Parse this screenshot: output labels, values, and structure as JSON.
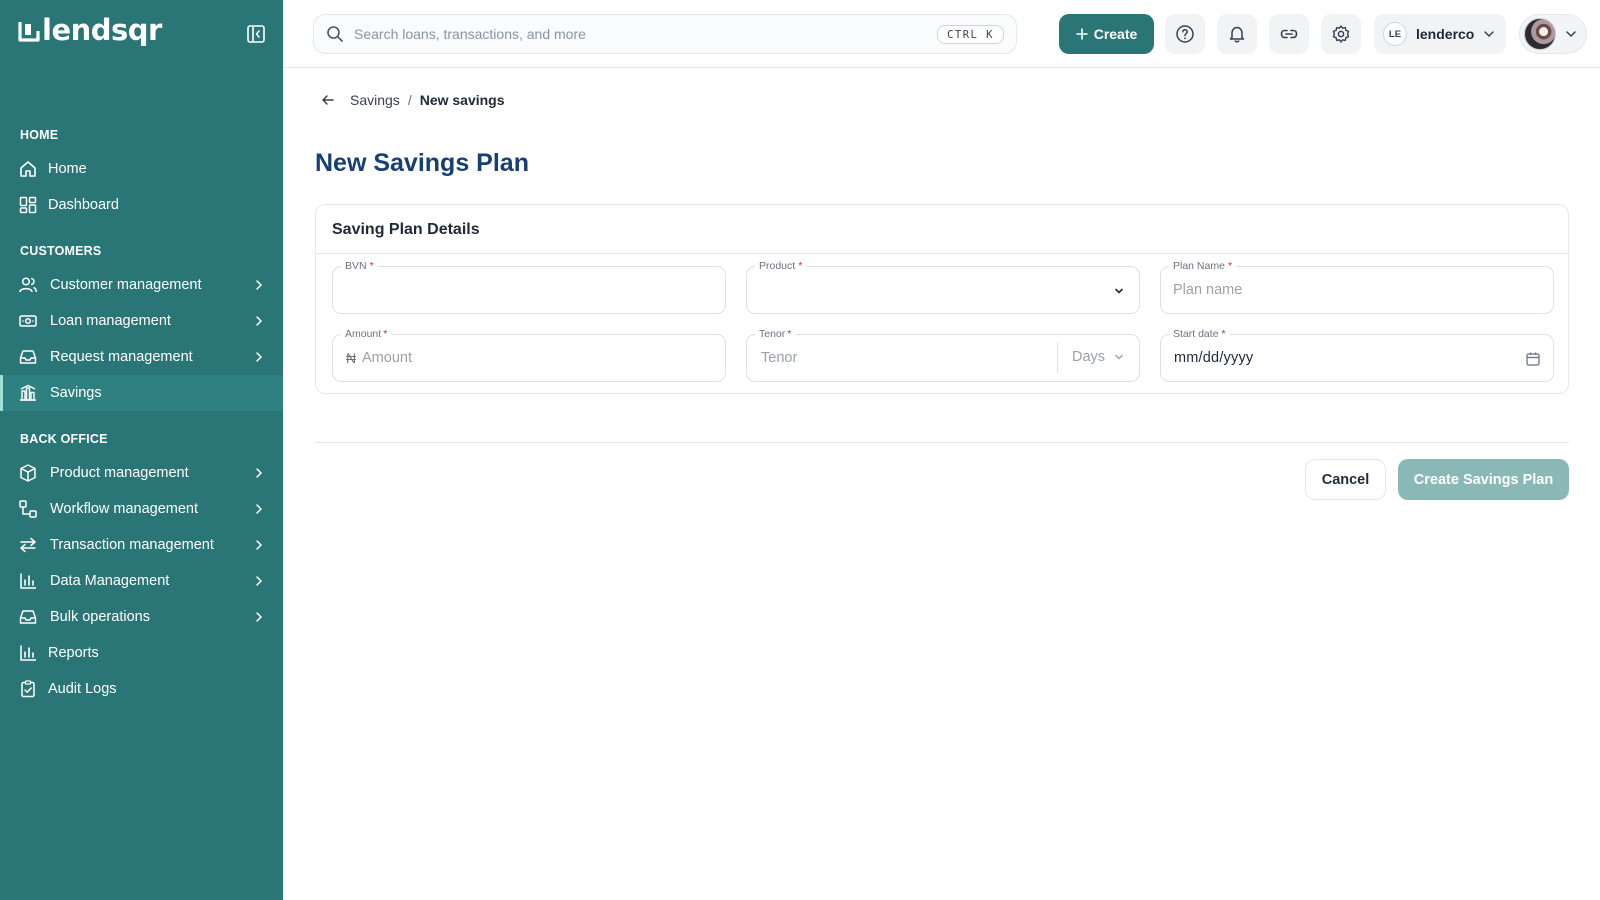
{
  "brand": {
    "logo_text": "lendsqr",
    "logo_icon": "lendsqr-logo-mark"
  },
  "sidebar": {
    "collapse_icon": "sidebar-collapse-icon",
    "sections": {
      "home": "HOME",
      "customers": "CUSTOMERS",
      "back_office": "BACK OFFICE"
    },
    "items": [
      {
        "label": "Home",
        "icon": "home-icon"
      },
      {
        "label": "Dashboard",
        "icon": "dashboard-grid-icon"
      },
      {
        "label": "Customer management",
        "icon": "users-icon"
      },
      {
        "label": "Loan management",
        "icon": "cash-icon"
      },
      {
        "label": "Request management",
        "icon": "inbox-icon"
      },
      {
        "label": "Savings",
        "icon": "bank-icon",
        "active": true
      },
      {
        "label": "Product management",
        "icon": "box-icon"
      },
      {
        "label": "Workflow management",
        "icon": "workflow-icon"
      },
      {
        "label": "Transaction management",
        "icon": "transfer-arrows-icon"
      },
      {
        "label": "Data Management",
        "icon": "bar-chart-icon"
      },
      {
        "label": "Bulk operations",
        "icon": "inbox-icon"
      },
      {
        "label": "Reports",
        "icon": "bar-chart-icon"
      },
      {
        "label": "Audit Logs",
        "icon": "clipboard-check-icon"
      }
    ]
  },
  "topbar": {
    "search": {
      "placeholder": "Search loans, transactions, and more",
      "shortcut": "CTRL K"
    },
    "create_label": "Create",
    "account": {
      "initials": "LE",
      "name": "lenderco"
    }
  },
  "breadcrumb": {
    "parent": "Savings",
    "separator": "/",
    "current": "New savings"
  },
  "page": {
    "title": "New Savings Plan"
  },
  "form": {
    "card_title": "Saving Plan Details",
    "fields": {
      "bvn": {
        "label": "BVN",
        "value": "",
        "placeholder": ""
      },
      "product": {
        "label": "Product",
        "value": ""
      },
      "plan_name": {
        "label": "Plan Name",
        "value": "",
        "placeholder": "Plan name"
      },
      "amount": {
        "label": "Amount",
        "currency_symbol": "₦",
        "value": "",
        "placeholder": "Amount"
      },
      "tenor": {
        "label": "Tenor",
        "value": "",
        "placeholder": "Tenor",
        "unit": "Days"
      },
      "start_date": {
        "label": "Start date",
        "value": "mm/dd/yyyy"
      }
    },
    "required_marker": "*"
  },
  "actions": {
    "cancel": "Cancel",
    "submit": "Create Savings Plan"
  },
  "colors": {
    "sidebar_bg": "#2a7575",
    "primary": "#2a7575",
    "primary_disabled": "#8ab8b6",
    "title": "#173f73",
    "required": "#dc2626"
  }
}
